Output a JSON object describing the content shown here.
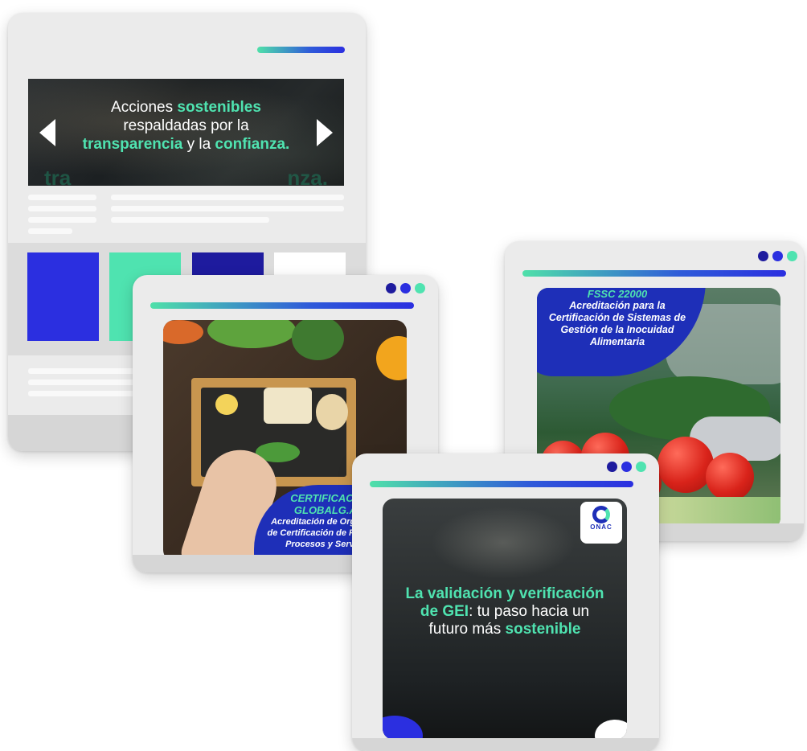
{
  "colors": {
    "accent_green": "#4fe3b0",
    "accent_blue": "#2b2fe0",
    "brand_navy": "#1e2fb8",
    "card_bg": "#ebebeb"
  },
  "hero_slide": {
    "line1_prefix": "Acciones ",
    "line1_highlight": "sostenibles",
    "line2": "respaldadas por la",
    "line3_highlight1": "transparencia",
    "line3_middle": " y la ",
    "line3_highlight2": "confianza.",
    "ghost_left": "tra",
    "ghost_right": "nza.",
    "prev_icon": "chevron-left-icon",
    "next_icon": "chevron-right-icon"
  },
  "tiles": [
    {
      "color": "#2b2fe0"
    },
    {
      "color": "#4fe3b0"
    },
    {
      "color": "#1e1b9e"
    },
    {
      "color": "#ffffff"
    }
  ],
  "fssc_card": {
    "title": "FSSC 22000",
    "line1": "Acreditación para la",
    "line2": "Certificación de Sistemas de",
    "line3": "Gestión de la Inocuidad",
    "line4": "Alimentaria"
  },
  "gap_card": {
    "title_line1": "CERTIFICACIÓN",
    "title_line2": "GLOBALG.A.P.",
    "line1": "Acreditación de Organismos",
    "line2": "de Certificación de Productos,",
    "line3": "Procesos y Servicios."
  },
  "gei_card": {
    "line1_prefix": "La ",
    "line1_highlight": "validación y verificación",
    "line2_highlight": "de GEI",
    "line2_rest": ": tu paso hacia un",
    "line3_prefix": "futuro más ",
    "line3_highlight": "sostenible",
    "logo_label": "ONAC"
  }
}
